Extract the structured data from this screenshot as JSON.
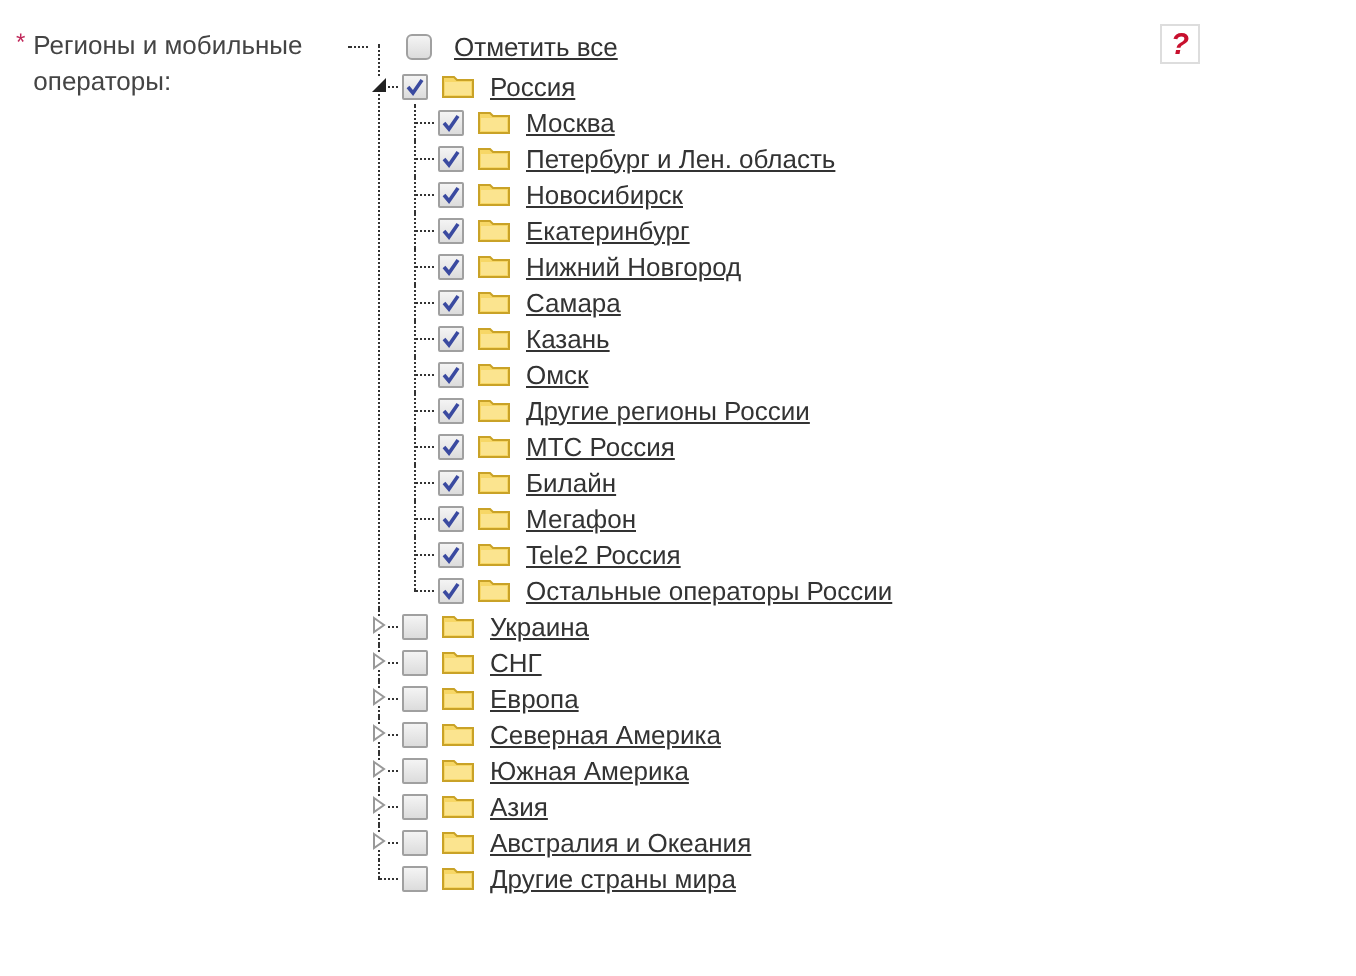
{
  "field": {
    "required_mark": "*",
    "label": "Регионы и мобильные операторы:",
    "help": "?"
  },
  "select_all": {
    "label": "Отметить все",
    "checked": false
  },
  "tree": {
    "items": [
      {
        "label": "Россия",
        "checked": true,
        "expanded": true,
        "children": [
          {
            "label": "Москва",
            "checked": true
          },
          {
            "label": "Петербург и Лен. область",
            "checked": true
          },
          {
            "label": "Новосибирск",
            "checked": true
          },
          {
            "label": "Екатеринбург",
            "checked": true
          },
          {
            "label": "Нижний Новгород",
            "checked": true
          },
          {
            "label": "Самара",
            "checked": true
          },
          {
            "label": "Казань",
            "checked": true
          },
          {
            "label": "Омск",
            "checked": true
          },
          {
            "label": "Другие регионы России",
            "checked": true
          },
          {
            "label": "МТС Россия",
            "checked": true
          },
          {
            "label": "Билайн",
            "checked": true
          },
          {
            "label": "Мегафон",
            "checked": true
          },
          {
            "label": "Tele2 Россия",
            "checked": true
          },
          {
            "label": "Остальные операторы России",
            "checked": true
          }
        ]
      },
      {
        "label": "Украина",
        "checked": false,
        "expanded": false
      },
      {
        "label": "СНГ",
        "checked": false,
        "expanded": false
      },
      {
        "label": "Европа",
        "checked": false,
        "expanded": false
      },
      {
        "label": "Северная Америка",
        "checked": false,
        "expanded": false
      },
      {
        "label": "Южная Америка",
        "checked": false,
        "expanded": false
      },
      {
        "label": "Азия",
        "checked": false,
        "expanded": false
      },
      {
        "label": "Австралия и Океания",
        "checked": false,
        "expanded": false
      },
      {
        "label": "Другие страны мира",
        "checked": false
      }
    ]
  }
}
